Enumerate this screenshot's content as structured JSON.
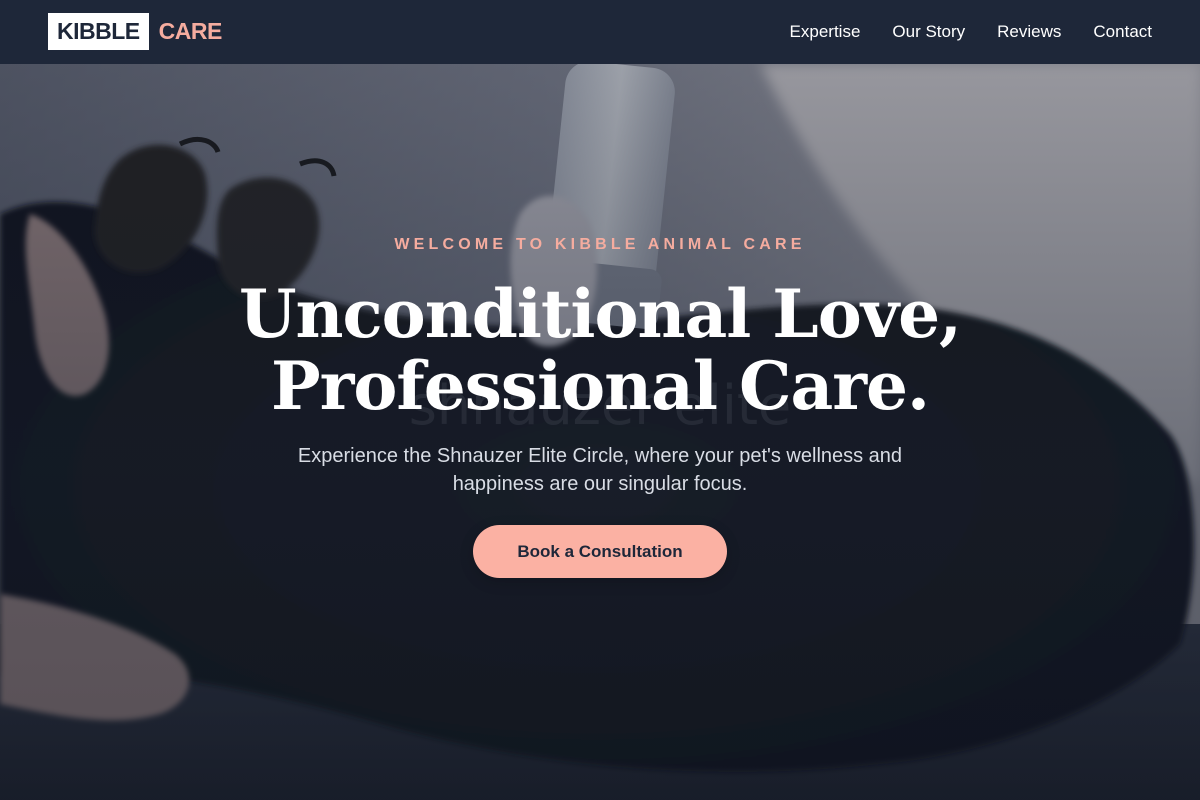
{
  "brand": {
    "logo_primary": "KIBBLE",
    "logo_accent": "CARE",
    "accent_color": "#f5ac9f",
    "header_color": "#1e2739"
  },
  "nav": {
    "items": [
      {
        "label": "Expertise"
      },
      {
        "label": "Our Story"
      },
      {
        "label": "Reviews"
      },
      {
        "label": "Contact"
      }
    ]
  },
  "hero": {
    "eyebrow": "WELCOME TO KIBBLE ANIMAL CARE",
    "headline_line1": "Unconditional Love,",
    "headline_line2": "Professional Care.",
    "subtitle": "Experience the Shnauzer Elite Circle, where your pet's wellness and happiness are our singular focus.",
    "cta_label": "Book a Consultation",
    "cta_color": "#fbb1a3",
    "background_image": "veterinarian-grooming-dark-dog-photo"
  }
}
